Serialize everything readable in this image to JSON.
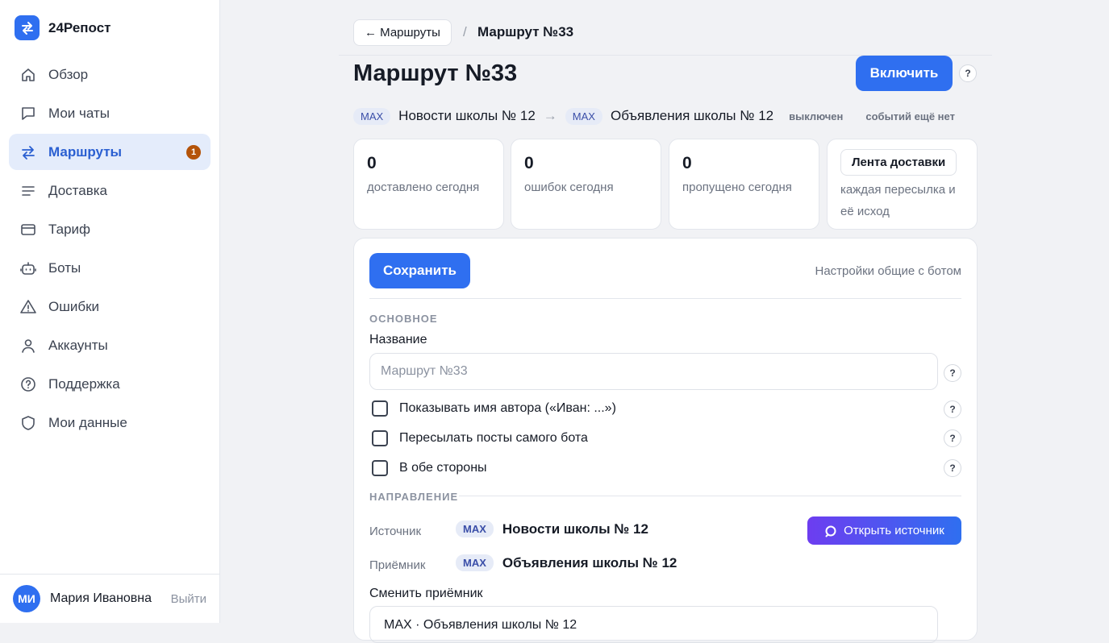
{
  "brand": {
    "name": "24Репост"
  },
  "sidebar": {
    "items": [
      {
        "label": "Обзор",
        "icon": "home-icon"
      },
      {
        "label": "Мои чаты",
        "icon": "chat-icon"
      },
      {
        "label": "Маршруты",
        "icon": "routes-icon",
        "badge": "1",
        "active": true
      },
      {
        "label": "Доставка",
        "icon": "list-icon"
      },
      {
        "label": "Тариф",
        "icon": "card-icon"
      },
      {
        "label": "Боты",
        "icon": "bot-icon"
      },
      {
        "label": "Ошибки",
        "icon": "warning-icon"
      },
      {
        "label": "Аккаунты",
        "icon": "user-icon"
      },
      {
        "label": "Поддержка",
        "icon": "help-circle-icon"
      },
      {
        "label": "Мои данные",
        "icon": "shield-icon"
      }
    ]
  },
  "user": {
    "initials": "МИ",
    "name": "Мария Ивановна",
    "logout": "Выйти"
  },
  "breadcrumb": {
    "back": "← Маршруты",
    "separator": "/",
    "current": "Маршрут №33"
  },
  "page": {
    "title": "Маршрут №33",
    "enable_label": "Включить",
    "help": "?"
  },
  "route": {
    "source_tag": "MAX",
    "source": "Новости школы № 12",
    "arrow": "→",
    "target_tag": "MAX",
    "target": "Объявления школы № 12",
    "status": "выключен",
    "events": "событий ещё нет"
  },
  "stats": [
    {
      "value": "0",
      "label": "доставлено сегодня"
    },
    {
      "value": "0",
      "label": "ошибок сегодня"
    },
    {
      "value": "0",
      "label": "пропущено сегодня"
    }
  ],
  "feed": {
    "label": "Лента доставки",
    "desc": "каждая пересылка и её исход"
  },
  "form": {
    "save_label": "Сохранить",
    "settings_note": "Настройки общие с ботом",
    "section_main": "ОСНОВНОЕ",
    "name_label": "Название",
    "name_placeholder": "Маршрут №33",
    "checkboxes": [
      {
        "label": "Показывать имя автора («Иван: ...»)",
        "checked": false
      },
      {
        "label": "Пересылать посты самого бота",
        "checked": false
      },
      {
        "label": "В обе стороны",
        "checked": false
      }
    ],
    "section_direction": "НАПРАВЛЕНИЕ",
    "source_label": "Источник",
    "source_tag": "MAX",
    "source_value": "Новости школы № 12",
    "open_source_label": "Открыть источник",
    "target_label": "Приёмник",
    "target_tag": "MAX",
    "target_value": "Объявления школы № 12",
    "change_target_label": "Сменить приёмник",
    "change_target_value": "MAX · Объявления школы № 12"
  },
  "colors": {
    "accent": "#2f6ff0",
    "badge": "#b45309",
    "active_bg": "#e4ecfb"
  }
}
